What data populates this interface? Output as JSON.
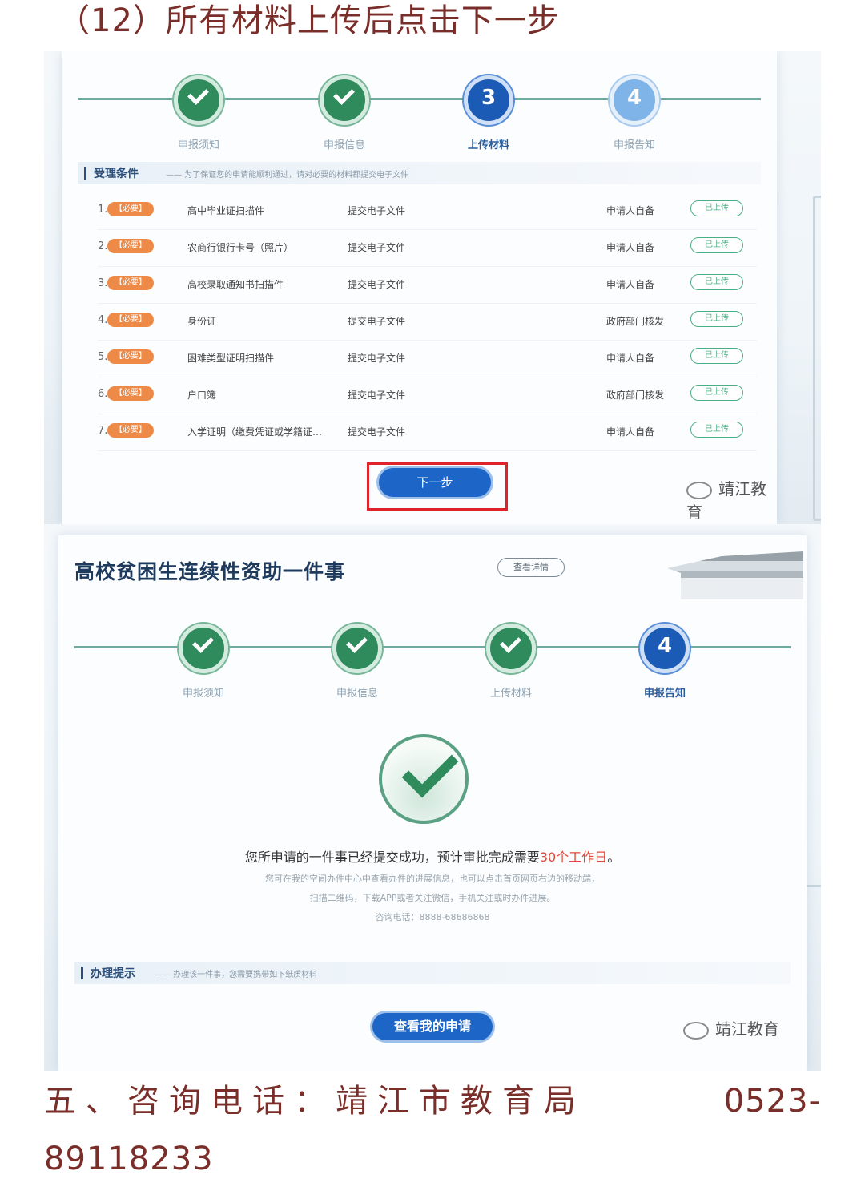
{
  "heading": "（12）所有材料上传后点击下一步",
  "screen1": {
    "steps": [
      {
        "label": "申报须知",
        "state": "done"
      },
      {
        "label": "申报信息",
        "state": "done"
      },
      {
        "label": "上传材料",
        "state": "current",
        "num": "3"
      },
      {
        "label": "申报告知",
        "state": "pending",
        "num": "4"
      }
    ],
    "section_title": "受理条件",
    "section_note": "—— 为了保证您的申请能顺利通过，请对必要的材料都提交电子文件",
    "rows": [
      {
        "idx": "1.",
        "req": "【必要】",
        "name": "高中毕业证扫描件",
        "type": "提交电子文件",
        "source": "申请人自备",
        "status": "已上传"
      },
      {
        "idx": "2.",
        "req": "【必要】",
        "name": "农商行银行卡号（照片）",
        "type": "提交电子文件",
        "source": "申请人自备",
        "status": "已上传"
      },
      {
        "idx": "3.",
        "req": "【必要】",
        "name": "高校录取通知书扫描件",
        "type": "提交电子文件",
        "source": "申请人自备",
        "status": "已上传"
      },
      {
        "idx": "4.",
        "req": "【必要】",
        "name": "身份证",
        "type": "提交电子文件",
        "source": "政府部门核发",
        "status": "已上传"
      },
      {
        "idx": "5.",
        "req": "【必要】",
        "name": "困难类型证明扫描件",
        "type": "提交电子文件",
        "source": "申请人自备",
        "status": "已上传"
      },
      {
        "idx": "6.",
        "req": "【必要】",
        "name": "户口簿",
        "type": "提交电子文件",
        "source": "政府部门核发",
        "status": "已上传"
      },
      {
        "idx": "7.",
        "req": "【必要】",
        "name": "入学证明（缴费凭证或学籍证…",
        "type": "提交电子文件",
        "source": "申请人自备",
        "status": "已上传"
      }
    ],
    "next_button": "下一步",
    "watermark": "靖江教育"
  },
  "screen2": {
    "title": "高校贫困生连续性资助一件事",
    "detail_button": "查看详情",
    "steps": [
      {
        "label": "申报须知",
        "state": "done"
      },
      {
        "label": "申报信息",
        "state": "done"
      },
      {
        "label": "上传材料",
        "state": "done"
      },
      {
        "label": "申报告知",
        "state": "current",
        "num": "4"
      }
    ],
    "msg_main_prefix": "您所申请的一件事已经提交成功，预计审批完成需要",
    "msg_main_highlight": "30个工作日",
    "msg_main_suffix": "。",
    "msg_line2": "您可在我的空间办件中心中查看办件的进展信息，也可以点击首页网页右边的移动端，",
    "msg_line3": "扫描二维码，下载APP或者关注微信，手机关注或时办件进展。",
    "msg_line4": "咨询电话：8888-68686868",
    "section_title": "办理提示",
    "section_note": "—— 办理该一件事，您需要携带如下纸质材料",
    "view_button": "查看我的申请",
    "watermark": "靖江教育"
  },
  "contact": {
    "label": "五、咨询电话：靖江市教育局",
    "phone_part1": "0523-",
    "phone_part2": "89118233"
  },
  "colors": {
    "heading_text": "#7a2e2a",
    "step_done": "#2f8a5c",
    "step_current": "#1c5bb5",
    "button_blue": "#1d66c7",
    "required_badge": "#ee8a48",
    "uploaded_green": "#4caf84",
    "highlight_red": "#e0232a"
  }
}
